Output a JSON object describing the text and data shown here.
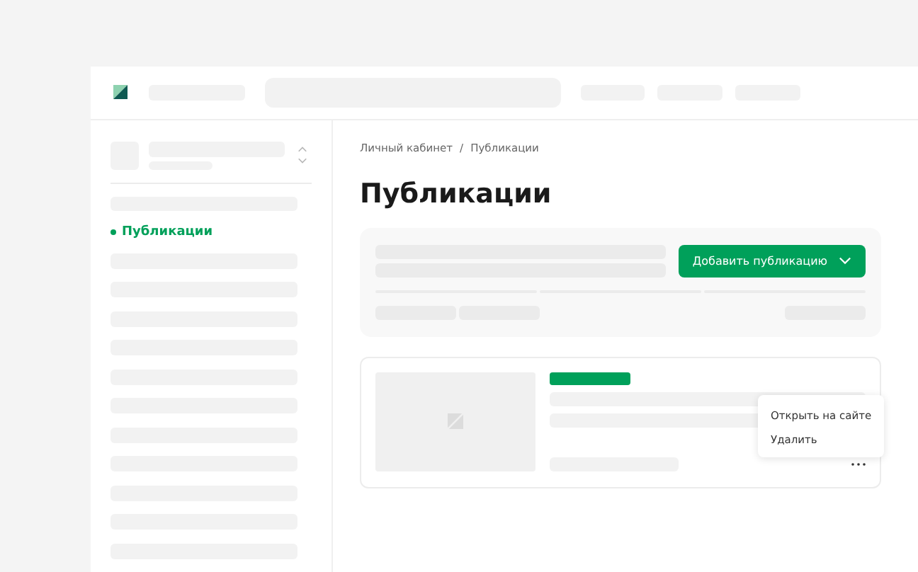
{
  "sidebar": {
    "nav_items": [
      {
        "label": "Публикации",
        "selected": true
      }
    ]
  },
  "breadcrumbs": {
    "items": [
      "Личный кабинет",
      "Публикации"
    ],
    "separator": "/"
  },
  "page_title": "Публикации",
  "toolbar": {
    "add_button": "Добавить публикацию"
  },
  "publication_menu": {
    "items": [
      "Открыть на сайте",
      "Удалить"
    ]
  }
}
